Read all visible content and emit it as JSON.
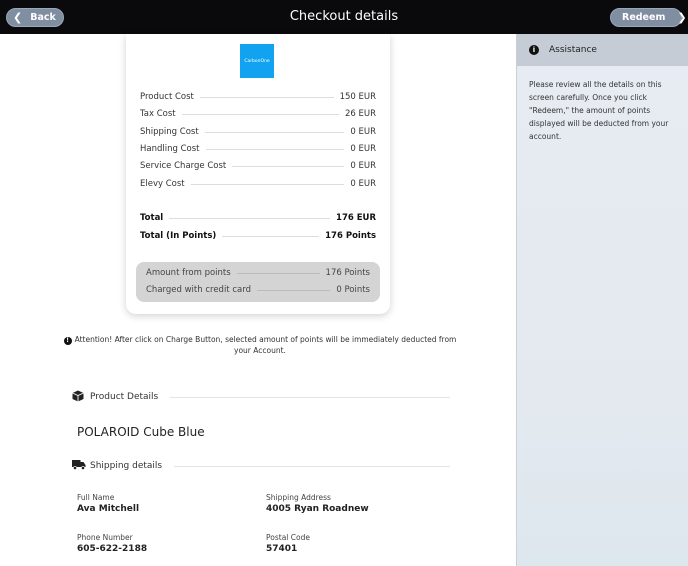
{
  "header": {
    "title": "Checkout details",
    "back_label": "Back",
    "redeem_label": "Redeem"
  },
  "summary": {
    "logo_text": "CarbonOne",
    "costs": [
      {
        "label": "Product Cost",
        "value": "150 EUR"
      },
      {
        "label": "Tax Cost",
        "value": "26 EUR"
      },
      {
        "label": "Shipping Cost",
        "value": "0 EUR"
      },
      {
        "label": "Handling Cost",
        "value": "0 EUR"
      },
      {
        "label": "Service Charge Cost",
        "value": "0 EUR"
      },
      {
        "label": "Elevy Cost",
        "value": "0 EUR"
      }
    ],
    "total_label": "Total",
    "total_value": "176 EUR",
    "total_points_label": "Total (In Points)",
    "total_points_value": "176 Points",
    "amount_from_points_label": "Amount from points",
    "amount_from_points_value": "176 Points",
    "credit_card_label": "Charged with credit card",
    "credit_card_value": "0 Points"
  },
  "attention": {
    "text": "Attention! After click on Charge Button, selected amount of points will be immediately deducted from your Account."
  },
  "product": {
    "section_title": "Product Details",
    "name": "POLAROID Cube Blue"
  },
  "shipping": {
    "section_title": "Shipping details",
    "full_name_label": "Full Name",
    "full_name": "Ava Mitchell",
    "address_label": "Shipping Address",
    "address": "4005 Ryan Roadnew",
    "phone_label": "Phone Number",
    "phone": "605-622-2188",
    "postal_label": "Postal Code",
    "postal": "57401"
  },
  "assistance": {
    "title": "Assistance",
    "text": "Please review all the details on this screen carefully. Once you click \"Redeem,\" the amount of points displayed will be deducted from your account."
  },
  "icons": {
    "back": "chevron-left-icon",
    "redeem": "chevron-right-icon",
    "info": "info-icon",
    "product": "box-icon",
    "shipping": "truck-icon"
  }
}
